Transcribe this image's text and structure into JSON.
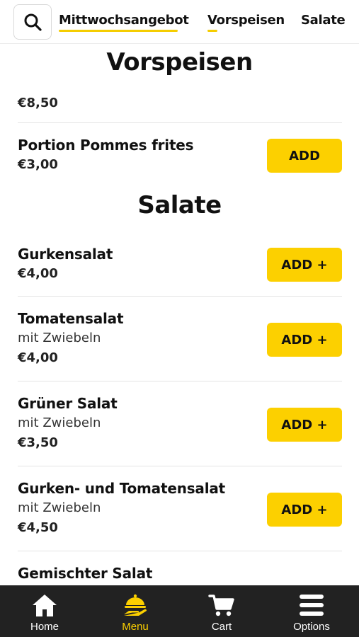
{
  "colors": {
    "accent": "#fcd000",
    "nav_bg": "#222222",
    "text": "#111111"
  },
  "category_tabs": [
    {
      "label": "Mittwochsangebot",
      "active": true
    },
    {
      "label": "Vorspeisen",
      "active": false
    },
    {
      "label": "Salate",
      "active": false
    }
  ],
  "sections": [
    {
      "title": "Vorspeisen",
      "items": [
        {
          "name": "",
          "desc": "",
          "price": "€8,50",
          "button": ""
        },
        {
          "name": "Portion Pommes frites",
          "desc": "",
          "price": "€3,00",
          "button": "ADD"
        }
      ]
    },
    {
      "title": "Salate",
      "items": [
        {
          "name": "Gurkensalat",
          "desc": "",
          "price": "€4,00",
          "button": "ADD +"
        },
        {
          "name": "Tomatensalat",
          "desc": "mit Zwiebeln",
          "price": "€4,00",
          "button": "ADD +"
        },
        {
          "name": "Grüner Salat",
          "desc": "mit Zwiebeln",
          "price": "€3,50",
          "button": "ADD +"
        },
        {
          "name": "Gurken- und Tomatensalat",
          "desc": "mit Zwiebeln",
          "price": "€4,50",
          "button": "ADD +"
        },
        {
          "name": "Gemischter Salat",
          "desc": "",
          "price": "",
          "button": ""
        }
      ]
    }
  ],
  "bottom_nav": [
    {
      "label": "Home",
      "icon": "home-icon",
      "active": false
    },
    {
      "label": "Menu",
      "icon": "serving-hand-icon",
      "active": true
    },
    {
      "label": "Cart",
      "icon": "cart-icon",
      "active": false
    },
    {
      "label": "Options",
      "icon": "menu-lines-icon",
      "active": false
    }
  ]
}
